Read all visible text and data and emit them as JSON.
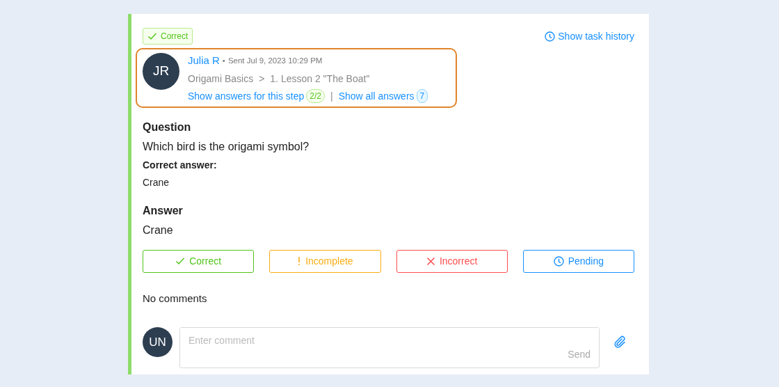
{
  "status_badge": {
    "kind": "correct",
    "label": "Correct"
  },
  "history_link": {
    "label": "Show task history"
  },
  "submission": {
    "avatar_initials": "JR",
    "author": "Julia R",
    "separator": "•",
    "sent": "Sent Jul 9, 2023 10:29 PM",
    "course": "Origami Basics",
    "breadcrumb_separator": ">",
    "lesson": "1. Lesson 2 \"The Boat\"",
    "step_answers_link": "Show answers for this step",
    "step_answers_count": "2/2",
    "divider": "|",
    "all_answers_link": "Show all answers",
    "all_answers_count": "7"
  },
  "question": {
    "heading": "Question",
    "text": "Which bird is the origami symbol?",
    "correct_label": "Correct answer:",
    "correct_text": "Crane"
  },
  "answer": {
    "heading": "Answer",
    "text": "Crane"
  },
  "grade_buttons": [
    {
      "kind": "correct",
      "label": "Correct"
    },
    {
      "kind": "incomplete",
      "label": "Incomplete"
    },
    {
      "kind": "incorrect",
      "label": "Incorrect"
    },
    {
      "kind": "pending",
      "label": "Pending"
    }
  ],
  "comments_status": "No comments",
  "comment_form": {
    "avatar_initials": "UN",
    "placeholder": "Enter comment",
    "send_label": "Send",
    "send_disabled": true
  }
}
